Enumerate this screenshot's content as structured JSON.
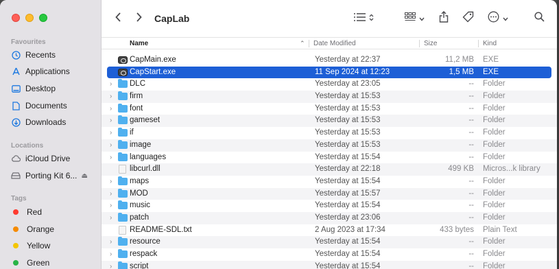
{
  "window": {
    "title": "CapLab"
  },
  "sidebar": {
    "favourites_label": "Favourites",
    "favourites": [
      {
        "label": "Recents",
        "icon": "clock-icon"
      },
      {
        "label": "Applications",
        "icon": "applications-icon"
      },
      {
        "label": "Desktop",
        "icon": "desktop-icon"
      },
      {
        "label": "Documents",
        "icon": "document-icon"
      },
      {
        "label": "Downloads",
        "icon": "download-icon"
      }
    ],
    "locations_label": "Locations",
    "locations": [
      {
        "label": "iCloud Drive",
        "icon": "cloud-icon"
      },
      {
        "label": "Porting Kit 6...",
        "icon": "disk-icon"
      }
    ],
    "tags_label": "Tags",
    "tags": [
      {
        "label": "Red",
        "color": "#fe3b30"
      },
      {
        "label": "Orange",
        "color": "#f58b00"
      },
      {
        "label": "Yellow",
        "color": "#f4c600"
      },
      {
        "label": "Green",
        "color": "#28b447"
      }
    ]
  },
  "columns": {
    "name": "Name",
    "date": "Date Modified",
    "size": "Size",
    "kind": "Kind"
  },
  "rows": [
    {
      "name": "CapMain.exe",
      "date": "Yesterday at 22:37",
      "size": "11,2 MB",
      "kind": "EXE",
      "type": "exe",
      "expandable": false
    },
    {
      "name": "CapStart.exe",
      "date": "11 Sep 2024 at 12:23",
      "size": "1,5 MB",
      "kind": "EXE",
      "type": "exe",
      "expandable": false,
      "selected": true
    },
    {
      "name": "DLC",
      "date": "Yesterday at 23:05",
      "size": "--",
      "kind": "Folder",
      "type": "folder",
      "expandable": true
    },
    {
      "name": "firm",
      "date": "Yesterday at 15:53",
      "size": "--",
      "kind": "Folder",
      "type": "folder",
      "expandable": true
    },
    {
      "name": "font",
      "date": "Yesterday at 15:53",
      "size": "--",
      "kind": "Folder",
      "type": "folder",
      "expandable": true
    },
    {
      "name": "gameset",
      "date": "Yesterday at 15:53",
      "size": "--",
      "kind": "Folder",
      "type": "folder",
      "expandable": true
    },
    {
      "name": "if",
      "date": "Yesterday at 15:53",
      "size": "--",
      "kind": "Folder",
      "type": "folder",
      "expandable": true
    },
    {
      "name": "image",
      "date": "Yesterday at 15:53",
      "size": "--",
      "kind": "Folder",
      "type": "folder",
      "expandable": true
    },
    {
      "name": "languages",
      "date": "Yesterday at 15:54",
      "size": "--",
      "kind": "Folder",
      "type": "folder",
      "expandable": true
    },
    {
      "name": "libcurl.dll",
      "date": "Yesterday at 22:18",
      "size": "499 KB",
      "kind": "Micros...k library",
      "type": "file",
      "expandable": false
    },
    {
      "name": "maps",
      "date": "Yesterday at 15:54",
      "size": "--",
      "kind": "Folder",
      "type": "folder",
      "expandable": true
    },
    {
      "name": "MOD",
      "date": "Yesterday at 15:57",
      "size": "--",
      "kind": "Folder",
      "type": "folder",
      "expandable": true
    },
    {
      "name": "music",
      "date": "Yesterday at 15:54",
      "size": "--",
      "kind": "Folder",
      "type": "folder",
      "expandable": true
    },
    {
      "name": "patch",
      "date": "Yesterday at 23:06",
      "size": "--",
      "kind": "Folder",
      "type": "folder",
      "expandable": true
    },
    {
      "name": "README-SDL.txt",
      "date": "2 Aug 2023 at 17:34",
      "size": "433 bytes",
      "kind": "Plain Text",
      "type": "file",
      "expandable": false
    },
    {
      "name": "resource",
      "date": "Yesterday at 15:54",
      "size": "--",
      "kind": "Folder",
      "type": "folder",
      "expandable": true
    },
    {
      "name": "respack",
      "date": "Yesterday at 15:54",
      "size": "--",
      "kind": "Folder",
      "type": "folder",
      "expandable": true
    },
    {
      "name": "script",
      "date": "Yesterday at 15:54",
      "size": "--",
      "kind": "Folder",
      "type": "folder",
      "expandable": true
    }
  ],
  "colors": {
    "accent": "#1d5fd6",
    "folder": "#4fb0ef"
  }
}
